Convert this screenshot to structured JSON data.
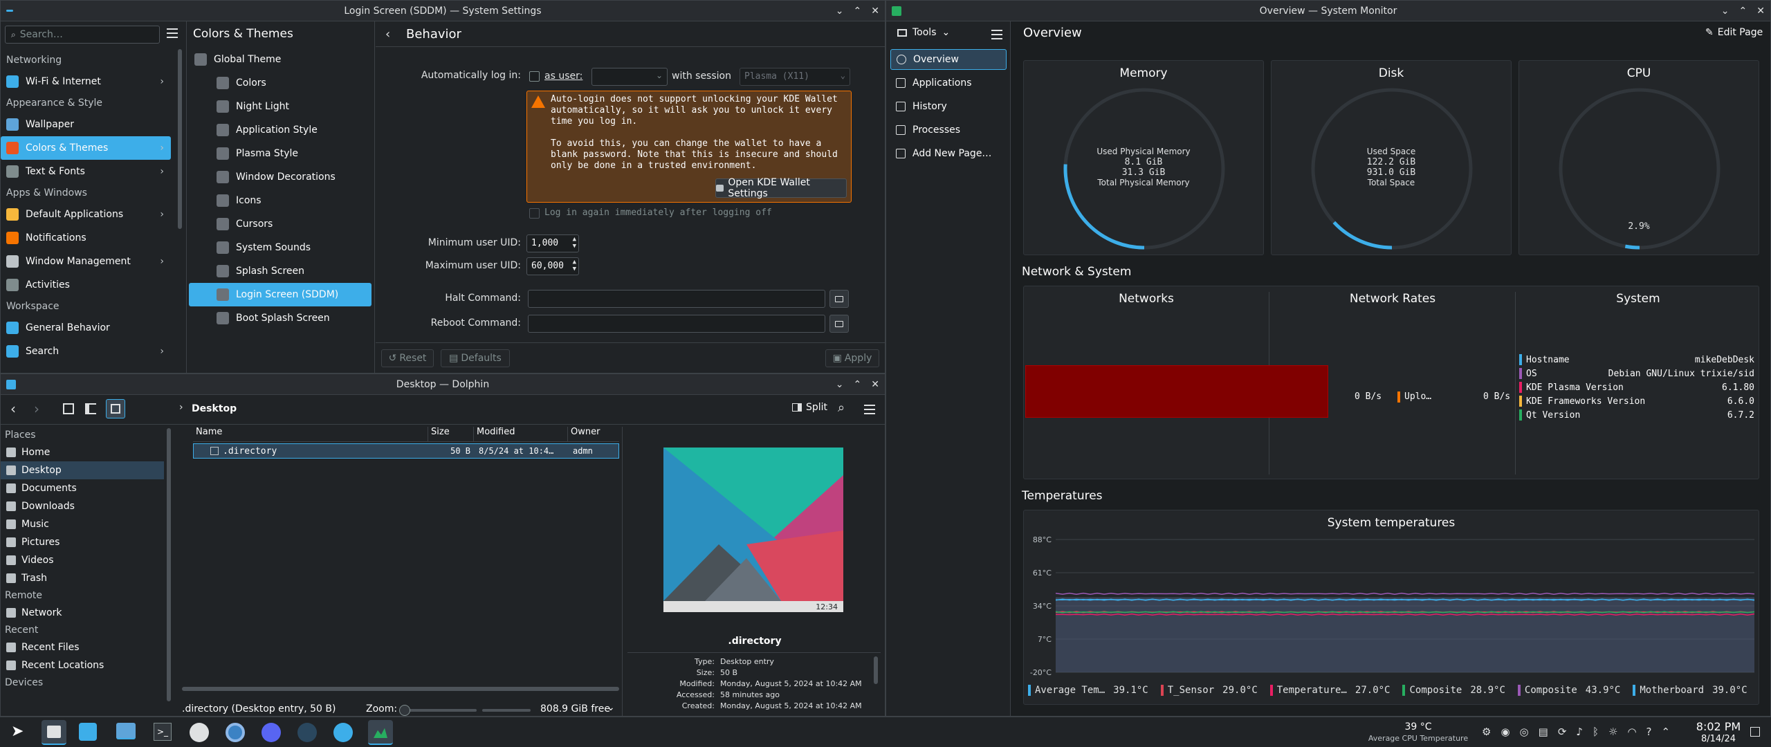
{
  "settings": {
    "title": "Login Screen (SDDM) — System Settings",
    "search_placeholder": "Search…",
    "categories": [
      {
        "type": "head",
        "label": "Networking"
      },
      {
        "type": "item",
        "label": "Wi-Fi & Internet",
        "chev": true,
        "color": "#3daee9"
      },
      {
        "type": "head",
        "label": "Appearance & Style"
      },
      {
        "type": "item",
        "label": "Wallpaper",
        "chev": false,
        "color": "#5ea4d9"
      },
      {
        "type": "item",
        "label": "Colors & Themes",
        "chev": true,
        "color": "#e95420",
        "selected": true
      },
      {
        "type": "item",
        "label": "Text & Fonts",
        "chev": true,
        "color": "#7f8c8d"
      },
      {
        "type": "head",
        "label": "Apps & Windows"
      },
      {
        "type": "item",
        "label": "Default Applications",
        "chev": true,
        "color": "#f6b73c"
      },
      {
        "type": "item",
        "label": "Notifications",
        "chev": false,
        "color": "#f67400"
      },
      {
        "type": "item",
        "label": "Window Management",
        "chev": true,
        "color": "#bdc3c7"
      },
      {
        "type": "item",
        "label": "Activities",
        "chev": false,
        "color": "#7f8c8d"
      },
      {
        "type": "head",
        "label": "Workspace"
      },
      {
        "type": "item",
        "label": "General Behavior",
        "chev": false,
        "color": "#3daee9"
      },
      {
        "type": "item",
        "label": "Search",
        "chev": true,
        "color": "#3daee9"
      }
    ],
    "sub_header": "Colors & Themes",
    "sub_items": [
      {
        "label": "Global Theme",
        "top": true
      },
      {
        "label": "Colors"
      },
      {
        "label": "Night Light"
      },
      {
        "label": "Application Style"
      },
      {
        "label": "Plasma Style"
      },
      {
        "label": "Window Decorations"
      },
      {
        "label": "Icons"
      },
      {
        "label": "Cursors"
      },
      {
        "label": "System Sounds"
      },
      {
        "label": "Splash Screen"
      },
      {
        "label": "Login Screen (SDDM)",
        "selected": true
      },
      {
        "label": "Boot Splash Screen"
      }
    ],
    "page_title": "Behavior",
    "autologin_label": "Automatically log in:",
    "as_user": "as user:",
    "with_session": "with session",
    "session_value": "Plasma (X11)",
    "warning_p1": "Auto-login does not support unlocking your KDE Wallet automatically, so it will ask you to unlock it every time you log in.",
    "warning_p2": "To avoid this, you can change the wallet to have a blank password. Note that this is insecure and should only be done in a trusted environment.",
    "wallet_button": "Open KDE Wallet Settings",
    "relogin_label": "Log in again immediately after logging off",
    "min_uid_label": "Minimum user UID:",
    "min_uid": "1,000",
    "max_uid_label": "Maximum user UID:",
    "max_uid": "60,000",
    "halt_label": "Halt Command:",
    "reboot_label": "Reboot Command:",
    "reset": "Reset",
    "defaults": "Defaults",
    "apply": "Apply"
  },
  "dolphin": {
    "title": "Desktop — Dolphin",
    "breadcrumb": "Desktop",
    "split": "Split",
    "places_head": "Places",
    "places": [
      "Home",
      "Desktop",
      "Documents",
      "Downloads",
      "Music",
      "Pictures",
      "Videos",
      "Trash"
    ],
    "remote_head": "Remote",
    "remote": [
      "Network"
    ],
    "recent_head": "Recent",
    "recent": [
      "Recent Files",
      "Recent Locations"
    ],
    "devices_head": "Devices",
    "columns": {
      "name": "Name",
      "size": "Size",
      "modified": "Modified",
      "owner": "Owner"
    },
    "file": {
      "name": ".directory",
      "size": "50 B",
      "modified": "8/5/24 at 10:4…",
      "owner": "admn"
    },
    "preview_name": ".directory",
    "preview_time": "12:34",
    "info": [
      {
        "k": "Type:",
        "v": "Desktop entry"
      },
      {
        "k": "Size:",
        "v": "50 B"
      },
      {
        "k": "Modified:",
        "v": "Monday, August 5, 2024 at 10:42 AM"
      },
      {
        "k": "Accessed:",
        "v": "58 minutes ago"
      },
      {
        "k": "Created:",
        "v": "Monday, August 5, 2024 at 10:42 AM"
      }
    ],
    "status": ".directory (Desktop entry, 50 B)",
    "zoom": "Zoom:",
    "free": "808.9 GiB free"
  },
  "monitor": {
    "title": "Overview — System Monitor",
    "tools": "Tools",
    "nav": [
      "Overview",
      "Applications",
      "History",
      "Processes",
      "Add New Page…"
    ],
    "page_title": "Overview",
    "edit_page": "Edit Page",
    "memory": {
      "title": "Memory",
      "l1": "Used Physical Memory",
      "v1": "8.1 GiB",
      "v2": "31.3 GiB",
      "l2": "Total Physical Memory",
      "fraction": 0.259
    },
    "disk": {
      "title": "Disk",
      "l1": "Used Space",
      "v1": "122.2 GiB",
      "v2": "931.0 GiB",
      "l2": "Total Space",
      "fraction": 0.131
    },
    "cpu": {
      "title": "CPU",
      "value": "2.9%",
      "fraction": 0.029
    },
    "net_section": "Network & System",
    "networks": "Networks",
    "network_rates": "Network Rates",
    "rate_down": "0 B/s",
    "rate_up_label": "Uplo…",
    "rate_up": "0 B/s",
    "system": "System",
    "sys_rows": [
      {
        "k": "Hostname",
        "v": "mikeDebDesk",
        "color": "#3daee9"
      },
      {
        "k": "OS",
        "v": "Debian GNU/Linux trixie/sid",
        "color": "#9b59b6"
      },
      {
        "k": "KDE Plasma Version",
        "v": "6.1.80",
        "color": "#e91e63"
      },
      {
        "k": "KDE Frameworks Version",
        "v": "6.6.0",
        "color": "#f6b73c"
      },
      {
        "k": "Qt Version",
        "v": "6.7.2",
        "color": "#27ae60"
      }
    ],
    "temp_section": "Temperatures",
    "temp_chart": {
      "title": "System temperatures",
      "ticks": [
        "88°C",
        "61°C",
        "34°C",
        "7°C",
        "-20°C"
      ],
      "legend": [
        {
          "k": "Average Tem…",
          "v": "39.1°C",
          "color": "#3daee9"
        },
        {
          "k": "T_Sensor",
          "v": "29.0°C",
          "color": "#da4453"
        },
        {
          "k": "Temperature…",
          "v": "27.0°C",
          "color": "#e91e63"
        },
        {
          "k": "Composite",
          "v": "28.9°C",
          "color": "#27ae60"
        },
        {
          "k": "Composite",
          "v": "43.9°C",
          "color": "#9b59b6"
        },
        {
          "k": "Motherboard",
          "v": "39.0°C",
          "color": "#3daee9"
        }
      ]
    }
  },
  "taskbar": {
    "temp_value": "39 °C",
    "temp_label": "Average CPU Temperature",
    "time": "8:02 PM",
    "date": "8/14/24"
  }
}
